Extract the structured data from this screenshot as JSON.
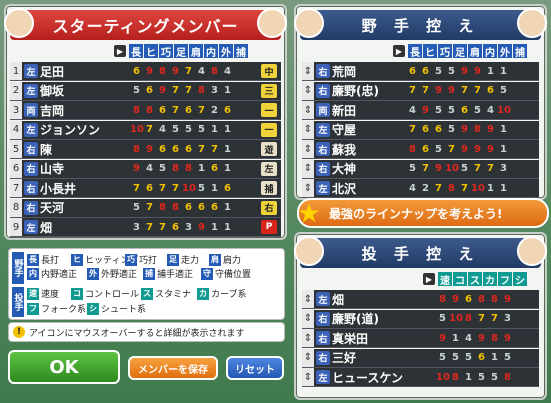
{
  "starting": {
    "title": "スターティングメンバー",
    "columns": [
      "長",
      "ヒ",
      "巧",
      "足",
      "肩",
      "内",
      "外",
      "捕"
    ],
    "rows": [
      {
        "num": "1",
        "hand": "左",
        "name": "足田",
        "stats": [
          "6",
          "9",
          "8",
          "9",
          "7",
          "4",
          "8",
          "4"
        ],
        "pos": "中"
      },
      {
        "num": "2",
        "hand": "左",
        "name": "御坂",
        "stats": [
          "5",
          "6",
          "9",
          "7",
          "7",
          "8",
          "3",
          "1"
        ],
        "pos": "三"
      },
      {
        "num": "3",
        "hand": "両",
        "name": "吉岡",
        "stats": [
          "8",
          "8",
          "6",
          "7",
          "6",
          "7",
          "2",
          "6"
        ],
        "pos": "一"
      },
      {
        "num": "4",
        "hand": "左",
        "name": "ジョンソン",
        "stats": [
          "10",
          "7",
          "4",
          "5",
          "5",
          "5",
          "1",
          "1"
        ],
        "pos": "一"
      },
      {
        "num": "5",
        "hand": "右",
        "name": "陳",
        "stats": [
          "8",
          "9",
          "6",
          "6",
          "6",
          "7",
          "7",
          "1"
        ],
        "pos": "遊"
      },
      {
        "num": "6",
        "hand": "右",
        "name": "山寺",
        "stats": [
          "9",
          "4",
          "5",
          "8",
          "8",
          "1",
          "6",
          "1"
        ],
        "pos": "左"
      },
      {
        "num": "7",
        "hand": "右",
        "name": "小長井",
        "stats": [
          "7",
          "6",
          "7",
          "7",
          "10",
          "5",
          "1",
          "6"
        ],
        "pos": "捕"
      },
      {
        "num": "8",
        "hand": "右",
        "name": "天河",
        "stats": [
          "5",
          "7",
          "8",
          "8",
          "6",
          "6",
          "6",
          "1"
        ],
        "pos": "右"
      },
      {
        "num": "9",
        "hand": "左",
        "name": "畑",
        "stats": [
          "3",
          "7",
          "7",
          "6",
          "3",
          "9",
          "1",
          "1"
        ],
        "pos": "P"
      }
    ]
  },
  "bench_fielders": {
    "title": "野 手 控 え",
    "columns": [
      "長",
      "ヒ",
      "巧",
      "足",
      "肩",
      "内",
      "外",
      "捕"
    ],
    "rows": [
      {
        "hand": "右",
        "name": "荒岡",
        "stats": [
          "6",
          "6",
          "5",
          "5",
          "9",
          "9",
          "1",
          "1"
        ]
      },
      {
        "hand": "右",
        "name": "廉野(忠)",
        "stats": [
          "7",
          "7",
          "9",
          "9",
          "7",
          "7",
          "6",
          "5"
        ]
      },
      {
        "hand": "両",
        "name": "新田",
        "stats": [
          "4",
          "9",
          "5",
          "5",
          "6",
          "5",
          "4",
          "10"
        ]
      },
      {
        "hand": "左",
        "name": "守屋",
        "stats": [
          "7",
          "6",
          "6",
          "5",
          "9",
          "8",
          "9",
          "1"
        ]
      },
      {
        "hand": "右",
        "name": "蘇我",
        "stats": [
          "8",
          "6",
          "5",
          "7",
          "9",
          "9",
          "9",
          "1"
        ]
      },
      {
        "hand": "右",
        "name": "大神",
        "stats": [
          "5",
          "7",
          "9",
          "10",
          "5",
          "7",
          "7",
          "3"
        ]
      },
      {
        "hand": "左",
        "name": "北沢",
        "stats": [
          "4",
          "2",
          "7",
          "8",
          "7",
          "10",
          "1",
          "1"
        ]
      }
    ]
  },
  "tip_banner": "最強のラインナップを考えよう!",
  "bench_pitchers": {
    "title": "投 手 控 え",
    "columns": [
      "速",
      "コ",
      "ス",
      "カ",
      "フ",
      "シ"
    ],
    "rows": [
      {
        "hand": "左",
        "name": "畑",
        "stats": [
          "8",
          "9",
          "6",
          "8",
          "8",
          "9"
        ]
      },
      {
        "hand": "右",
        "name": "廉野(道)",
        "stats": [
          "5",
          "10",
          "8",
          "7",
          "7",
          "3"
        ]
      },
      {
        "hand": "右",
        "name": "真栄田",
        "stats": [
          "9",
          "1",
          "4",
          "9",
          "8",
          "9"
        ]
      },
      {
        "hand": "右",
        "name": "三好",
        "stats": [
          "5",
          "5",
          "5",
          "6",
          "1",
          "5"
        ]
      },
      {
        "hand": "左",
        "name": "ヒュースケン",
        "stats": [
          "10",
          "8",
          "1",
          "5",
          "5",
          "8"
        ]
      }
    ]
  },
  "legend": {
    "fielder_tag": "野手",
    "pitcher_tag": "投手",
    "fielder_items": [
      {
        "key": "長",
        "text": "長打"
      },
      {
        "key": "ヒ",
        "text": "ヒッティング"
      },
      {
        "key": "巧",
        "text": "巧打"
      },
      {
        "key": "足",
        "text": "走力"
      },
      {
        "key": "肩",
        "text": "肩力"
      },
      {
        "key": "内",
        "text": "内野適正"
      },
      {
        "key": "外",
        "text": "外野適正"
      },
      {
        "key": "捕",
        "text": "捕手適正"
      },
      {
        "key": "守",
        "text": "守備位置"
      }
    ],
    "pitcher_items": [
      {
        "key": "速",
        "text": "速度"
      },
      {
        "key": "コ",
        "text": "コントロール"
      },
      {
        "key": "ス",
        "text": "スタミナ"
      },
      {
        "key": "カ",
        "text": "カーブ系"
      },
      {
        "key": "フ",
        "text": "フォーク系"
      },
      {
        "key": "シ",
        "text": "シュート系"
      }
    ]
  },
  "hint": "アイコンにマウスオーバーすると詳細が表示されます",
  "buttons": {
    "ok": "OK",
    "save": "メンバーを保存",
    "reset": "リセット"
  },
  "colors": {
    "accent_red": "#c4221e",
    "header_blue": "#245bb5",
    "header_teal": "#109a92",
    "row_dark": "#2c3236",
    "ok_green": "#3a9b28",
    "save_orange": "#e77a12",
    "reset_blue": "#2d66c4",
    "high_stat": "#e0271d",
    "mid_stat": "#f2c200"
  }
}
